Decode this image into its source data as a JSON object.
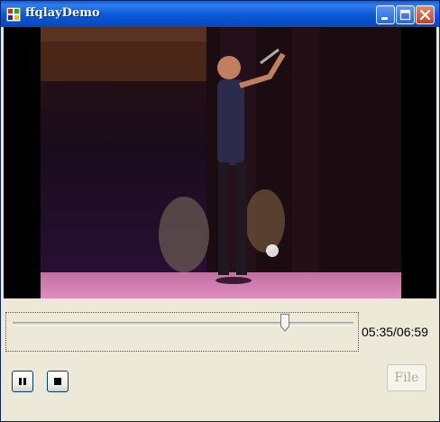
{
  "window": {
    "title": "ffqlayDemo"
  },
  "playback": {
    "time_text": "05:35/06:59",
    "position_fraction": 0.8
  },
  "buttons": {
    "file_label": "File"
  },
  "icons": [
    "app-icon",
    "minimize-icon",
    "maximize-icon",
    "close-icon",
    "pause-icon",
    "stop-icon"
  ]
}
